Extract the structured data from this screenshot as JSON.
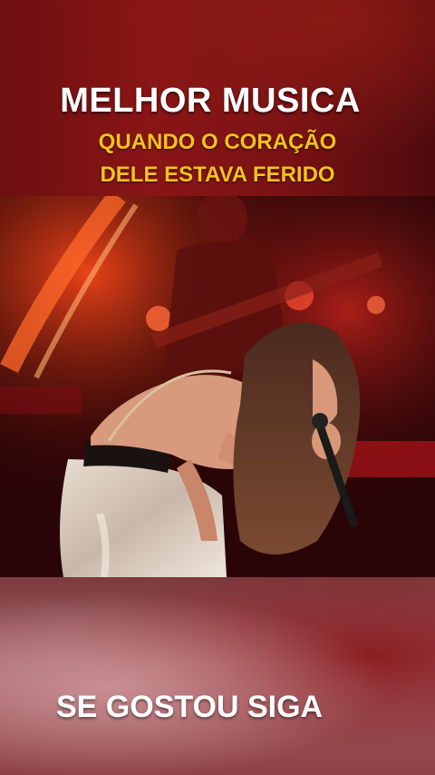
{
  "headline": {
    "title": "MELHOR MUSICA",
    "subtitle_line1": "QUANDO O CORAÇÃO",
    "subtitle_line2": "DELE ESTAVA FERIDO"
  },
  "footer": {
    "call_to_action": "SE GOSTOU SIGA"
  },
  "colors": {
    "title_text": "#ffffff",
    "subtitle_text": "#f4c21a",
    "band_red": "#7a1214"
  },
  "photo": {
    "subject": "singer-with-microphone-on-stage"
  }
}
